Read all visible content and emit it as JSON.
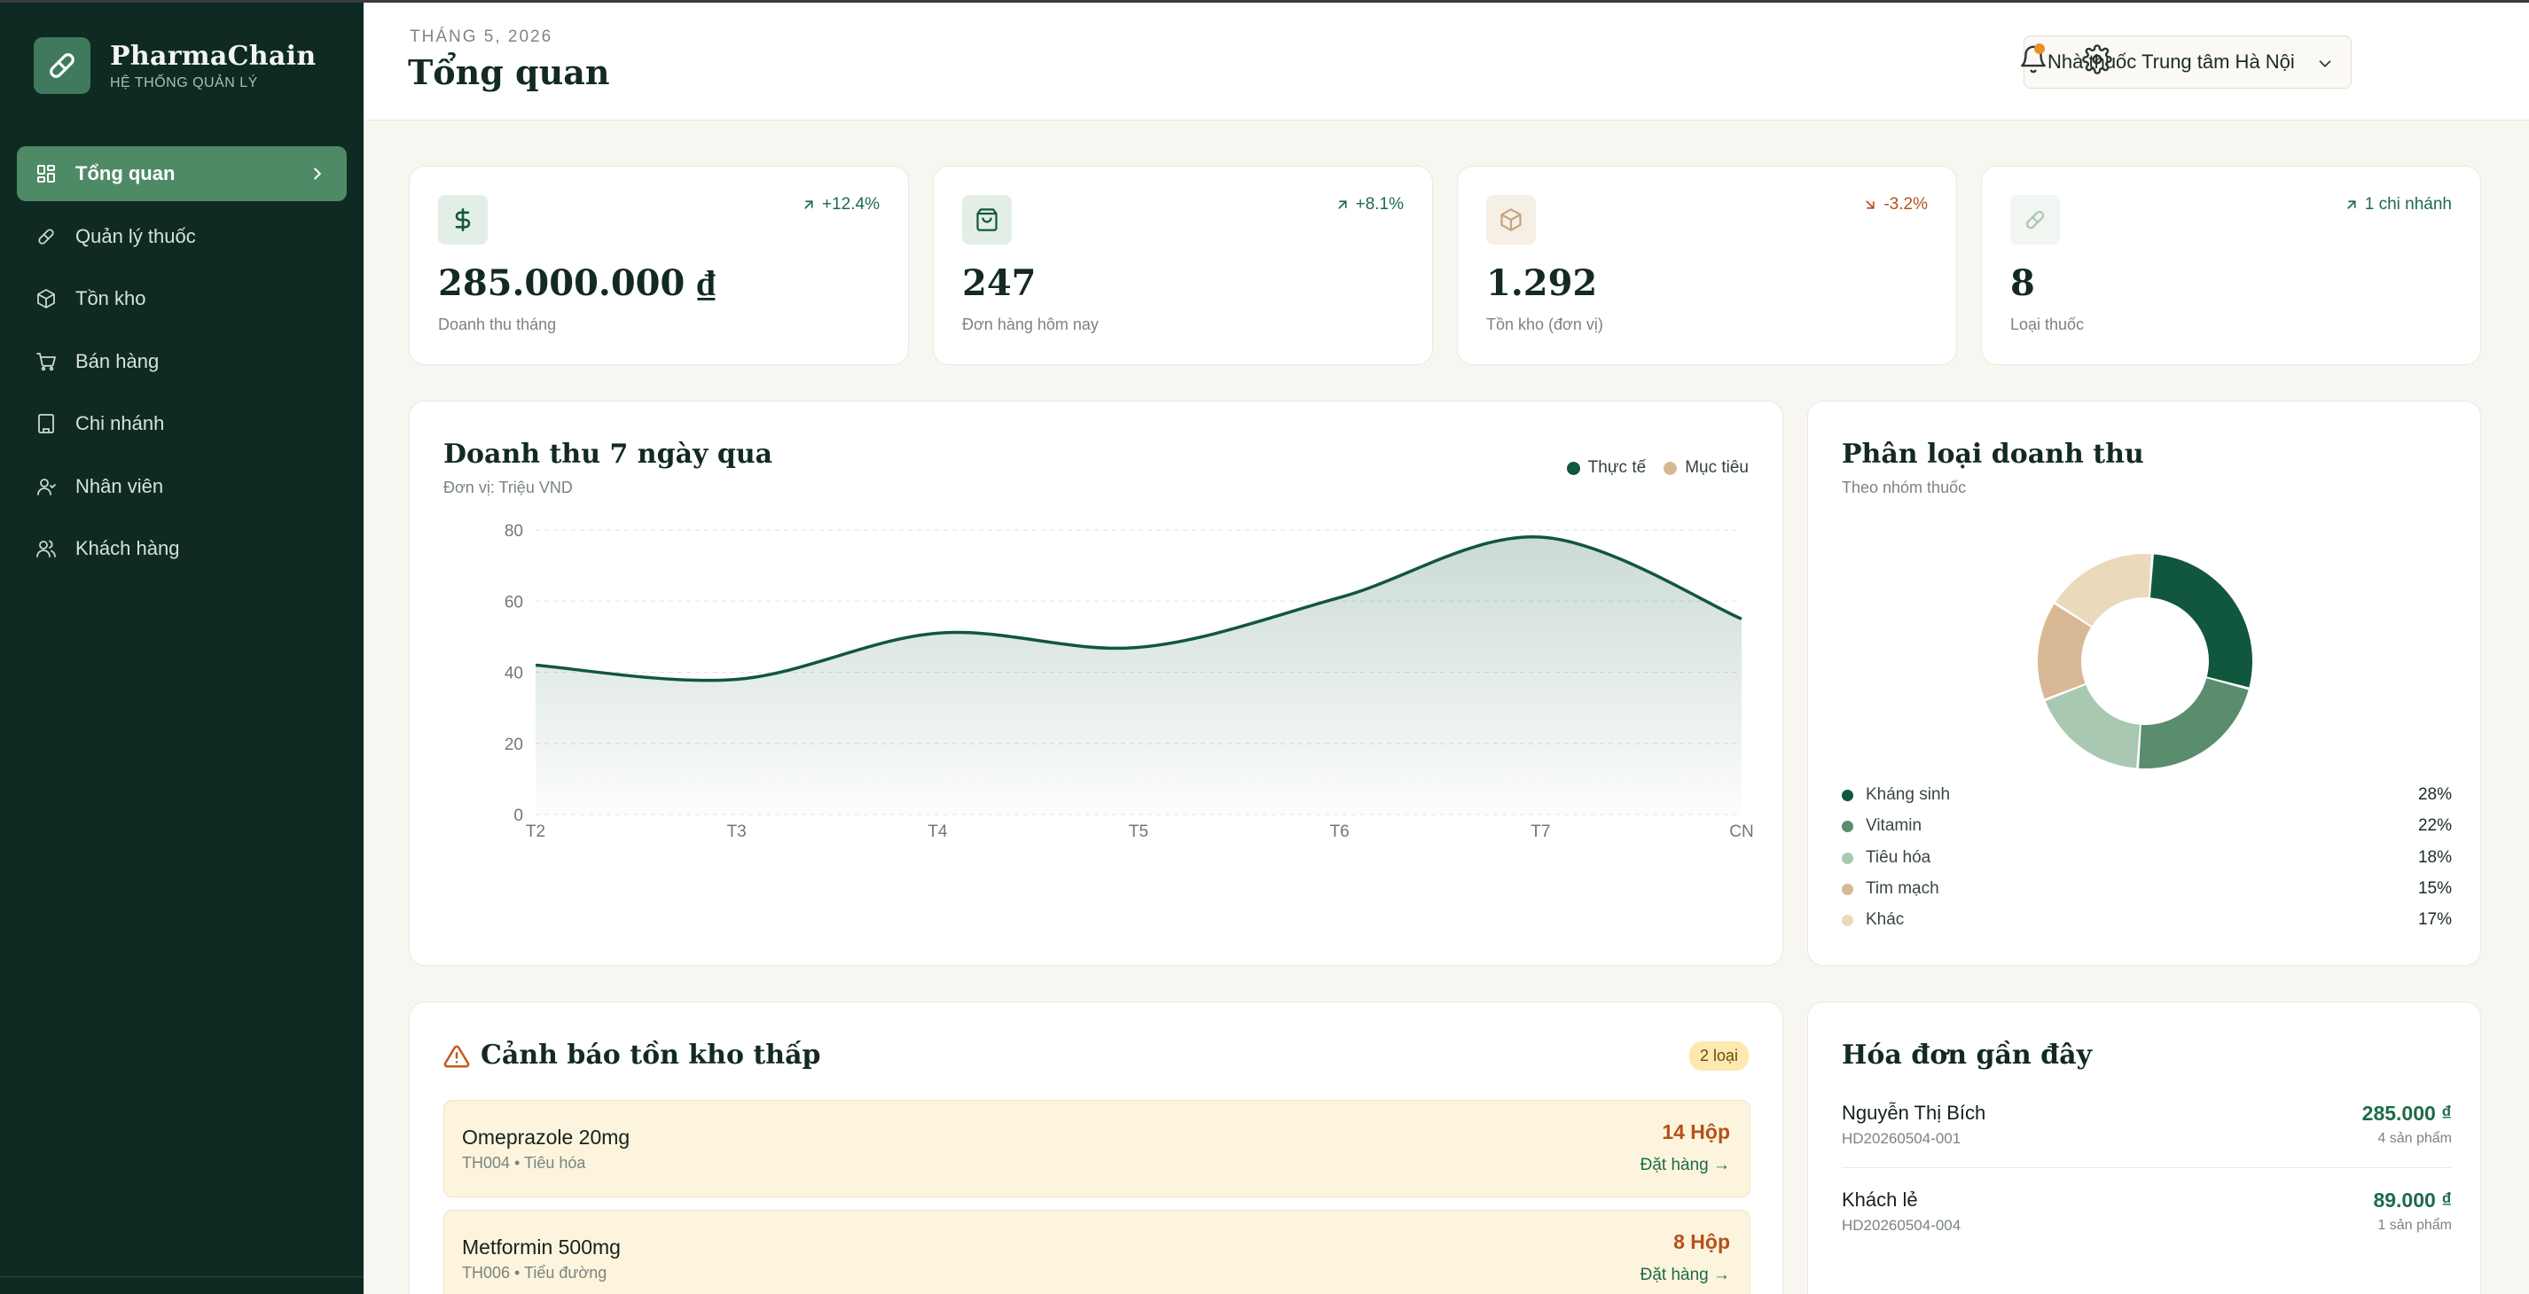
{
  "app": {
    "name": "PharmaChain",
    "subtitle": "HỆ THỐNG QUẢN LÝ"
  },
  "sidebar": {
    "items": [
      {
        "label": "Tổng quan",
        "icon": "grid-icon",
        "active": true
      },
      {
        "label": "Quản lý thuốc",
        "icon": "pill-icon"
      },
      {
        "label": "Tồn kho",
        "icon": "box-icon"
      },
      {
        "label": "Bán hàng",
        "icon": "cart-icon"
      },
      {
        "label": "Chi nhánh",
        "icon": "building-icon"
      },
      {
        "label": "Nhân viên",
        "icon": "user-icon"
      },
      {
        "label": "Khách hàng",
        "icon": "users-icon"
      }
    ]
  },
  "header": {
    "date": "THÁNG 5, 2026",
    "title": "Tổng quan",
    "branch": "Nhà thuốc Trung tâm Hà Nội"
  },
  "stats": [
    {
      "value": "285.000.000 ₫",
      "label": "Doanh thu tháng",
      "change": "+12.4%",
      "trend": "up",
      "icon": "dollar-icon"
    },
    {
      "value": "247",
      "label": "Đơn hàng hôm nay",
      "change": "+8.1%",
      "trend": "up",
      "icon": "bag-icon"
    },
    {
      "value": "1.292",
      "label": "Tồn kho (đơn vị)",
      "change": "-3.2%",
      "trend": "down",
      "icon": "box-icon"
    },
    {
      "value": "8",
      "label": "Loại thuốc",
      "change": "1 chi nhánh",
      "trend": "up",
      "icon": "pill-icon"
    }
  ],
  "revenue_chart": {
    "title": "Doanh thu 7 ngày qua",
    "subtitle": "Đơn vị: Triệu VND",
    "legend": [
      "Thực tế",
      "Mục tiêu"
    ]
  },
  "chart_data": {
    "type": "area",
    "categories": [
      "T2",
      "T3",
      "T4",
      "T5",
      "T6",
      "T7",
      "CN"
    ],
    "series": [
      {
        "name": "Thực tế",
        "values": [
          42,
          38,
          51,
          47,
          61,
          78,
          55
        ]
      }
    ],
    "yticks": [
      0,
      20,
      40,
      60,
      80
    ],
    "ylim": [
      0,
      80
    ],
    "grid": true,
    "legend_position": "top-right"
  },
  "category_chart": {
    "title": "Phân loại doanh thu",
    "subtitle": "Theo nhóm thuốc",
    "slices": [
      {
        "name": "Kháng sinh",
        "value": 28,
        "label": "28%",
        "color": "#11573d"
      },
      {
        "name": "Vitamin",
        "value": 22,
        "label": "22%",
        "color": "#5a8d6e"
      },
      {
        "name": "Tiêu hóa",
        "value": 18,
        "label": "18%",
        "color": "#a8c8b1"
      },
      {
        "name": "Tim mạch",
        "value": 15,
        "label": "15%",
        "color": "#d8b894"
      },
      {
        "name": "Khác",
        "value": 17,
        "label": "17%",
        "color": "#ead9bb"
      }
    ]
  },
  "low_stock": {
    "title": "Cảnh báo tồn kho thấp",
    "badge": "2 loại",
    "items": [
      {
        "name": "Omeprazole 20mg",
        "code": "TH004 • Tiêu hóa",
        "qty": "14 Hộp",
        "action": "Đặt hàng →"
      },
      {
        "name": "Metformin 500mg",
        "code": "TH006 • Tiểu đường",
        "qty": "8 Hộp",
        "action": "Đặt hàng →"
      }
    ]
  },
  "invoices": {
    "title": "Hóa đơn gần đây",
    "items": [
      {
        "customer": "Nguyễn Thị Bích",
        "code": "HD20260504-001",
        "amount": "285.000 ₫",
        "count": "4 sản phẩm"
      },
      {
        "customer": "Khách lẻ",
        "code": "HD20260504-004",
        "amount": "89.000 ₫",
        "count": "1 sản phẩm"
      }
    ]
  },
  "colors": {
    "sidebar_bg": "#0e2a22",
    "accent": "#11573d",
    "active_nav": "#4e8a66",
    "target": "#d8b894",
    "warning": "#b6501a"
  }
}
